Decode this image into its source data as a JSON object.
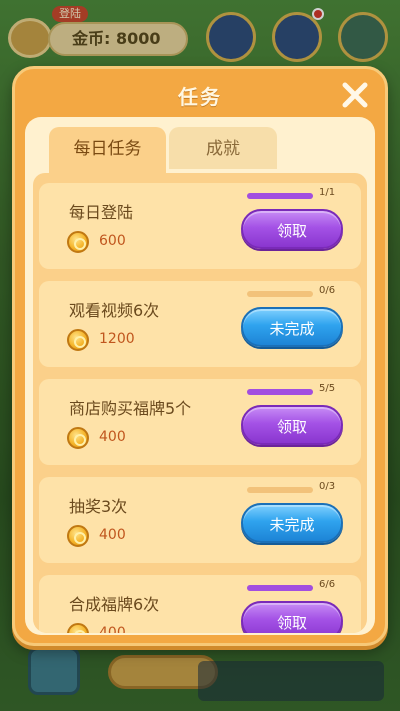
{
  "background": {
    "login_tag": "登陆",
    "coin_label": "金币: 8000"
  },
  "modal": {
    "title": "任务",
    "close_icon": "close-x-icon"
  },
  "tabs": [
    {
      "label": "每日任务",
      "active": true
    },
    {
      "label": "成就",
      "active": false
    }
  ],
  "tasks": [
    {
      "name": "每日登陆",
      "reward": "600",
      "progress_text": "1/1",
      "progress": 1.0,
      "button": "领取",
      "state": "claim"
    },
    {
      "name": "观看视频6次",
      "reward": "1200",
      "progress_text": "0/6",
      "progress": 0.0,
      "button": "未完成",
      "state": "incomplete"
    },
    {
      "name": "商店购买福牌5个",
      "reward": "400",
      "progress_text": "5/5",
      "progress": 1.0,
      "button": "领取",
      "state": "claim"
    },
    {
      "name": "抽奖3次",
      "reward": "400",
      "progress_text": "0/3",
      "progress": 0.0,
      "button": "未完成",
      "state": "incomplete"
    },
    {
      "name": "合成福牌6次",
      "reward": "400",
      "progress_text": "6/6",
      "progress": 1.0,
      "button": "领取",
      "state": "claim"
    }
  ],
  "colors": {
    "modal_orange": "#f3a843",
    "claim_purple": "#a452e6",
    "incomplete_blue": "#2fa3ee",
    "progress_purple": "#a24ee0"
  }
}
